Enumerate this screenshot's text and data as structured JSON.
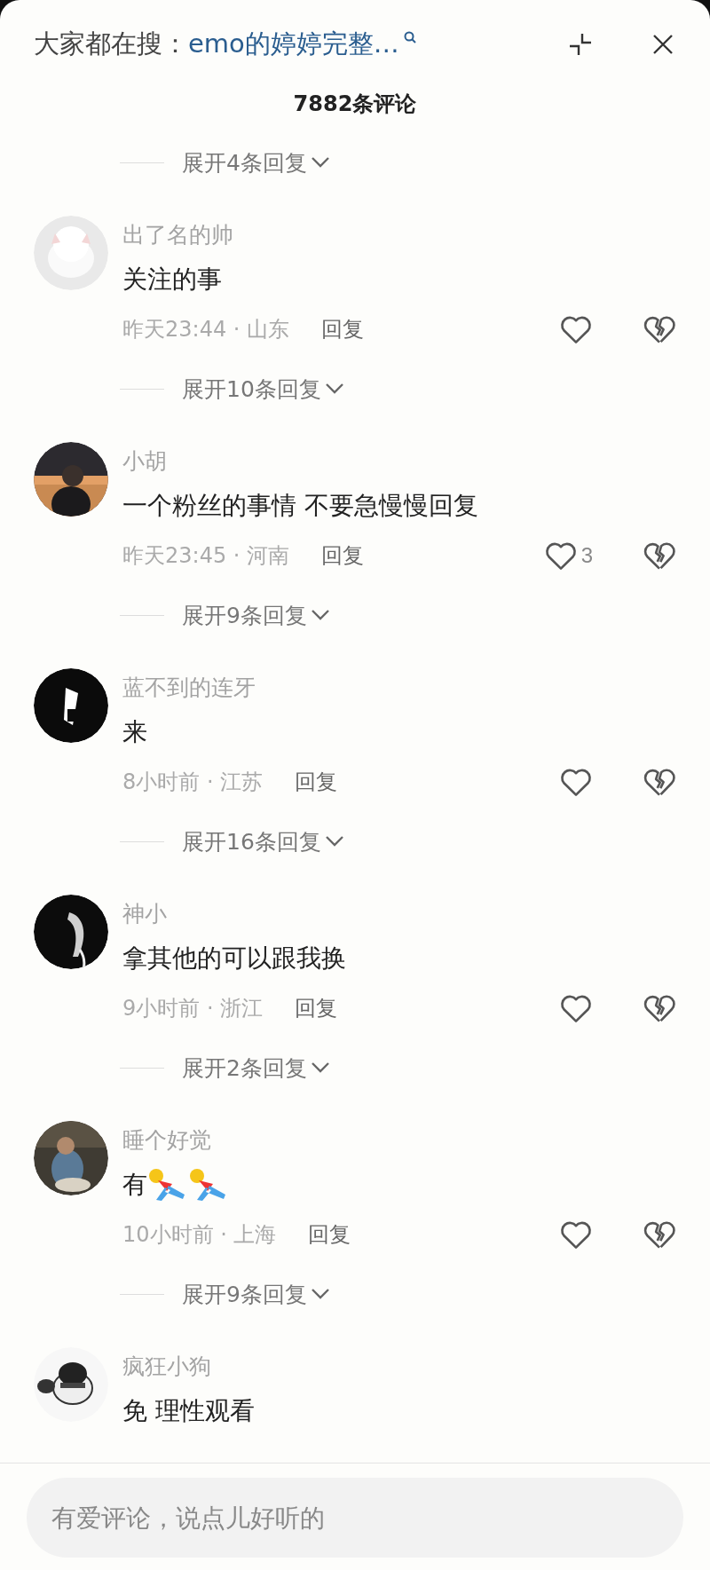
{
  "header": {
    "prefix": "大家都在搜：",
    "query": "emo的婷婷完整…"
  },
  "title": "7882条评论",
  "top_expand": "展开4条回复",
  "comments": [
    {
      "name": "出了名的帅",
      "text": "关注的事",
      "meta": "昨天23:44 · 山东",
      "reply": "回复",
      "replies_label": "展开10条回复"
    },
    {
      "name": "小胡",
      "text": "一个粉丝的事情 不要急慢慢回复",
      "meta": "昨天23:45 · 河南",
      "reply": "回复",
      "likes": "3",
      "replies_label": "展开9条回复"
    },
    {
      "name": "蓝不到的连牙",
      "text": "来",
      "meta": "8小时前 · 江苏",
      "reply": "回复",
      "replies_label": "展开16条回复"
    },
    {
      "name": "神小",
      "text": "拿其他的可以跟我换",
      "meta": "9小时前 · 浙江",
      "reply": "回复",
      "replies_label": "展开2条回复"
    },
    {
      "name": "睡个好觉",
      "text": "有",
      "emojis": [
        {
          "kind": "sticker"
        },
        {
          "kind": "sticker"
        }
      ],
      "meta": "10小时前 · 上海",
      "reply": "回复",
      "replies_label": "展开9条回复"
    },
    {
      "name": "疯狂小狗",
      "text": "免 理性观看"
    }
  ],
  "input": {
    "placeholder": "有爱评论，说点儿好听的"
  }
}
